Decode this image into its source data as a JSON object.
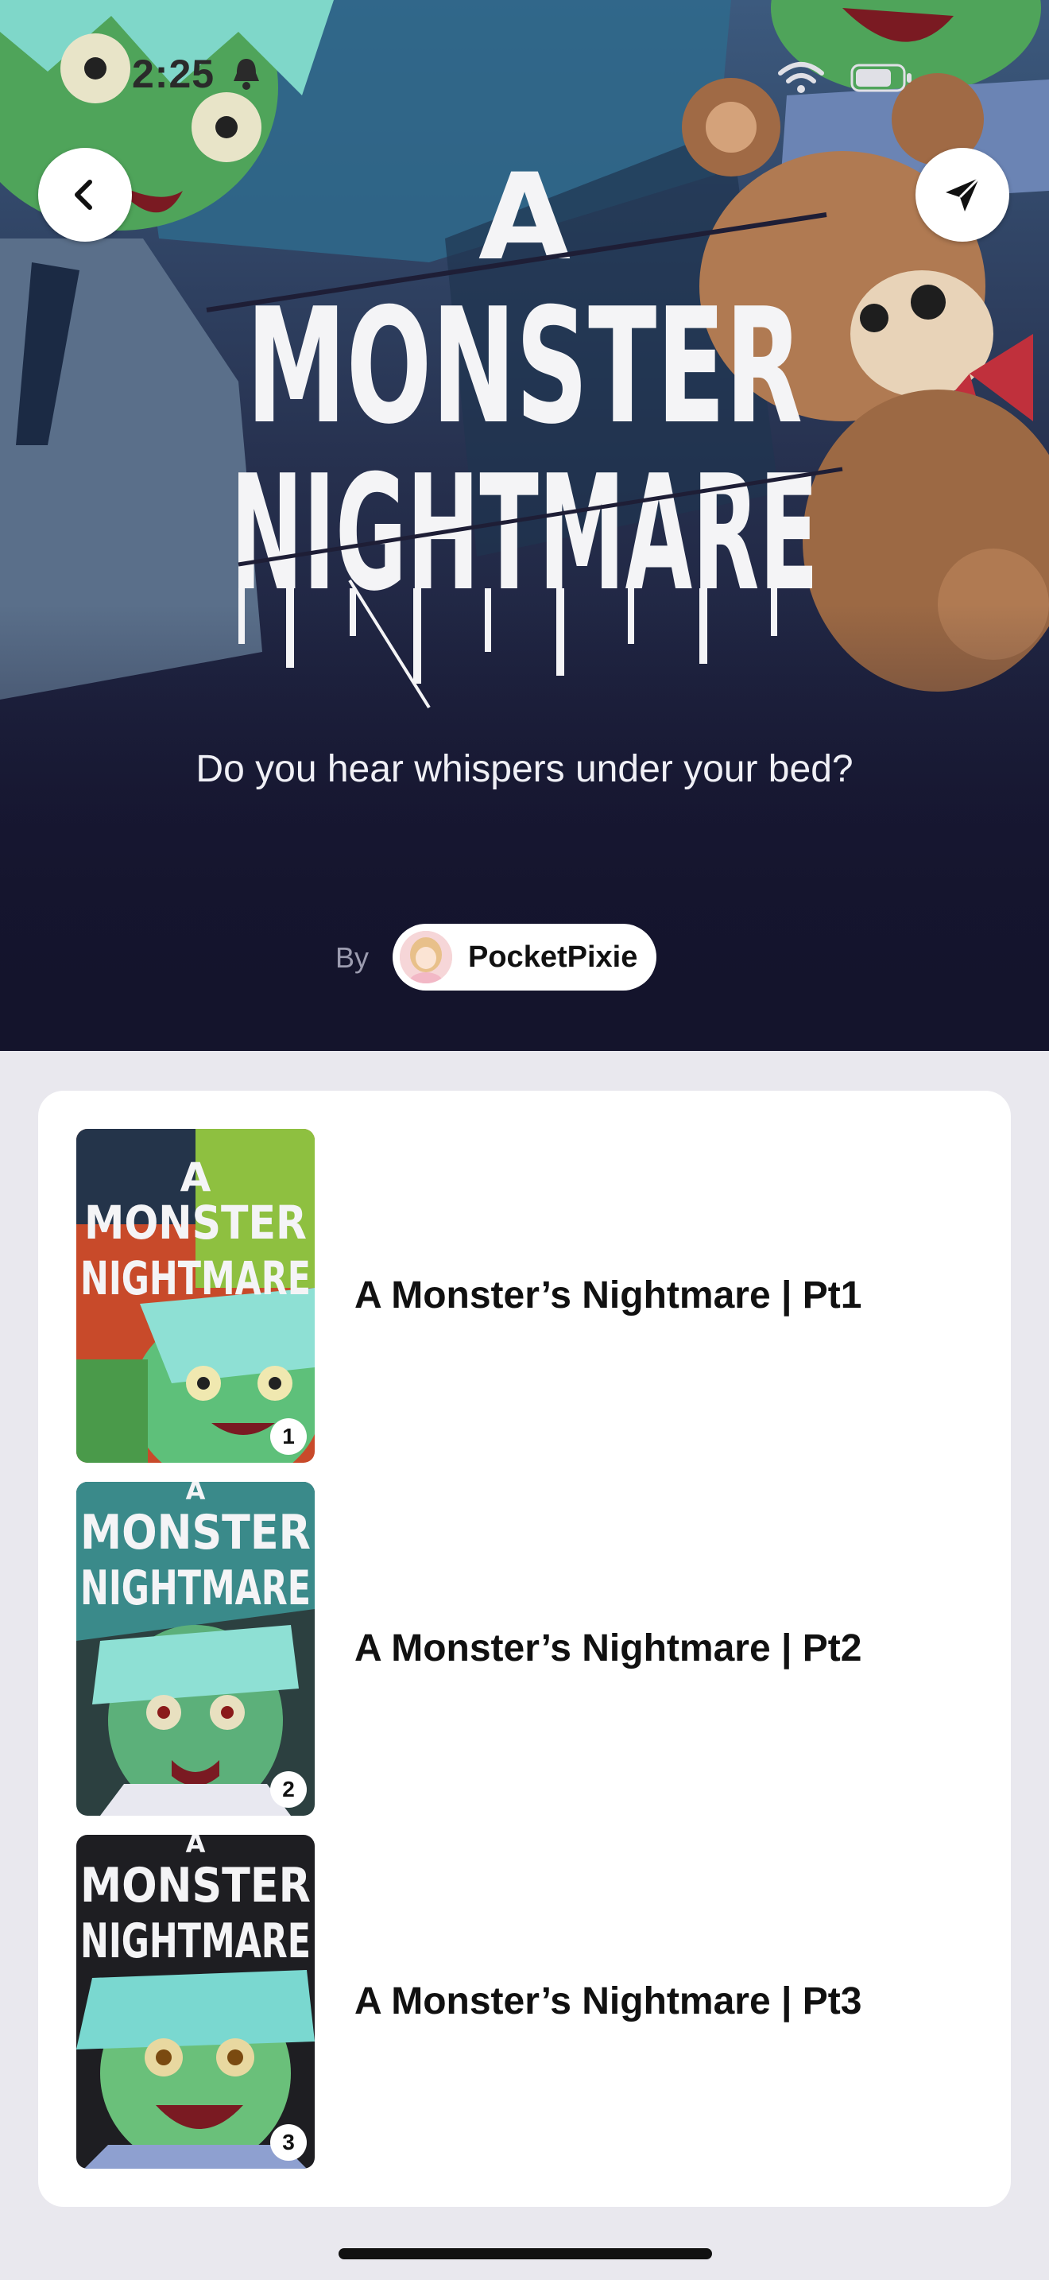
{
  "status_bar": {
    "time": "2:25"
  },
  "hero": {
    "title_line1": "A",
    "title_line2": "MONSTER",
    "title_line3": "NIGHTMARE",
    "subtitle": "Do you hear whispers under your bed?",
    "by_label": "By",
    "author": "PocketPixie",
    "colors": {
      "background": "#161630",
      "accent_green": "#6fc25b",
      "bear": "#b07a52"
    }
  },
  "episodes": [
    {
      "title": "A Monster’s Nightmare | Pt1",
      "number": "1",
      "cover_lines": [
        "A",
        "MONSTER",
        "NIGHTMARE"
      ]
    },
    {
      "title": "A Monster’s Nightmare | Pt2",
      "number": "2",
      "cover_lines": [
        "A",
        "MONSTER",
        "NIGHTMARE"
      ]
    },
    {
      "title": "A Monster’s Nightmare | Pt3",
      "number": "3",
      "cover_lines": [
        "A",
        "MONSTER",
        "NIGHTMARE"
      ]
    }
  ],
  "icons": {
    "back": "chevron-left-icon",
    "share": "paper-plane-icon",
    "notification": "bell-icon",
    "wifi": "wifi-icon",
    "battery": "battery-icon"
  }
}
